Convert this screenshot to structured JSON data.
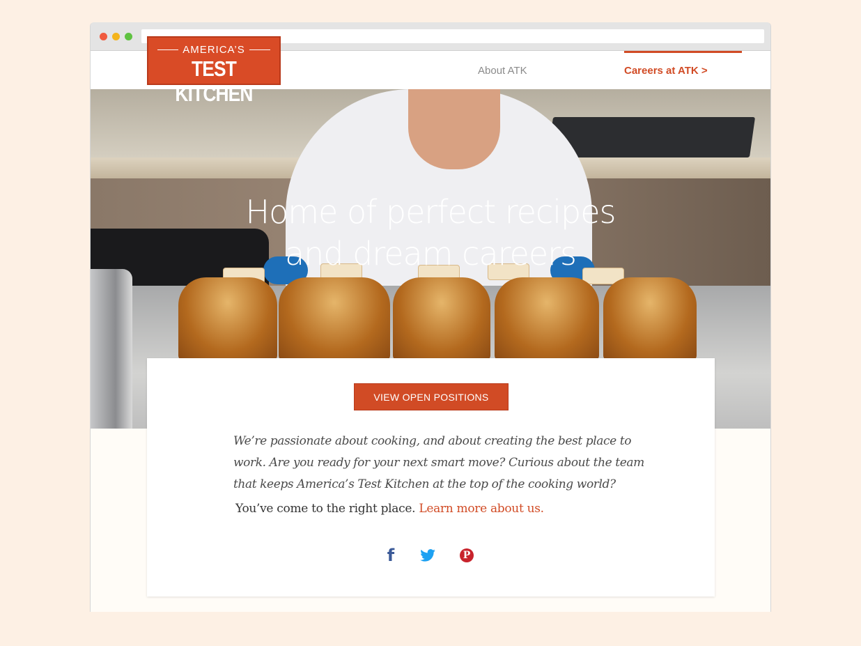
{
  "browser": {
    "window_controls": [
      "close",
      "minimize",
      "maximize"
    ],
    "url": ""
  },
  "nav": {
    "logo": {
      "top_line": "AMERICA’S",
      "bottom_line": "TEST KITCHEN"
    },
    "links": {
      "about": "About ATK",
      "careers": "Careers at ATK >"
    },
    "active_link": "careers",
    "colors": {
      "accent": "#d14b25",
      "muted_link": "#8a8a8a"
    }
  },
  "hero": {
    "title_line1": "Home of perfect recipes",
    "title_line2": "and dream careers"
  },
  "card": {
    "cta_label": "VIEW OPEN POSITIONS",
    "intro": "We’re passionate about cooking, and about creating the best place to work. Are you ready for your next smart move?  Curious about the team that keeps America’s Test Kitchen at the top of the cooking world?",
    "followup_text": "You’ve come to the right place.",
    "learn_more_link": "Learn more about us.",
    "social": {
      "facebook_glyph": "f",
      "pinterest_glyph": "P",
      "icons": [
        "facebook-icon",
        "twitter-icon",
        "pinterest-icon"
      ],
      "colors": {
        "facebook": "#3b5a98",
        "twitter": "#1da1f2",
        "pinterest": "#c8232c"
      }
    }
  },
  "colors": {
    "page_background": "#fdf0e4",
    "brand": "#d94b26"
  }
}
